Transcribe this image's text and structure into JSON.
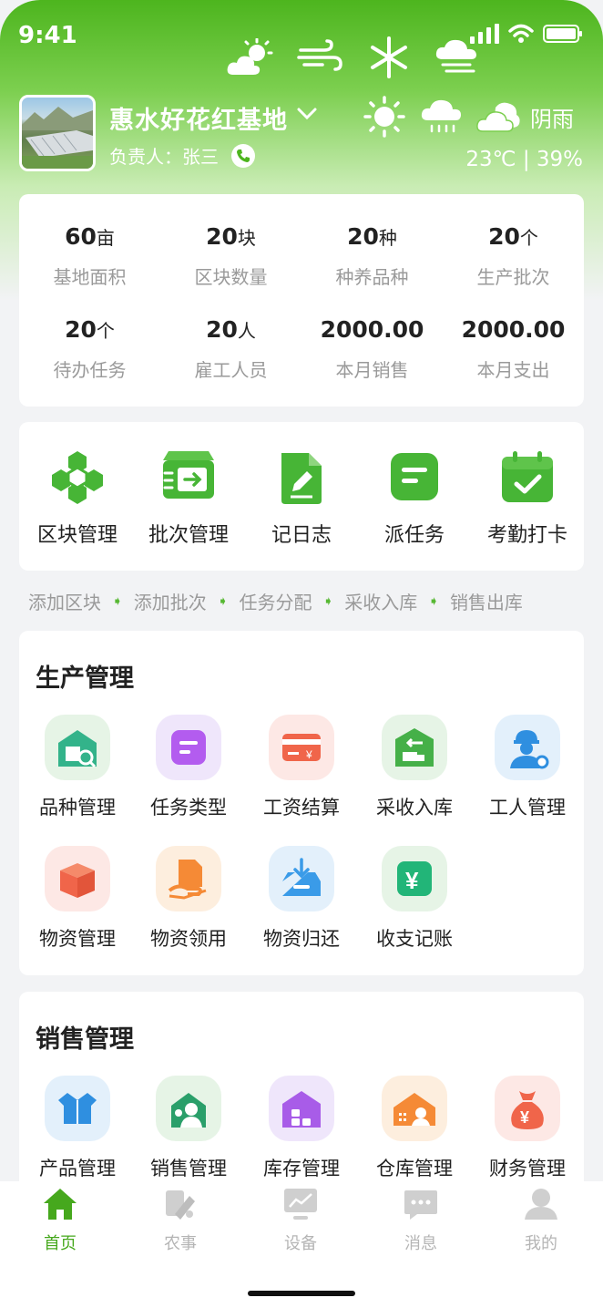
{
  "status_bar": {
    "time": "9:41"
  },
  "header": {
    "base_name": "惠水好花红基地",
    "manager": "负责人：张三",
    "weather_label": "阴雨",
    "temperature": "23℃",
    "humidity": "39%",
    "temp_humidity": "23℃ | 39%"
  },
  "stats": [
    {
      "value": "60",
      "unit": "亩",
      "label": "基地面积"
    },
    {
      "value": "20",
      "unit": "块",
      "label": "区块数量"
    },
    {
      "value": "20",
      "unit": "种",
      "label": "种养品种"
    },
    {
      "value": "20",
      "unit": "个",
      "label": "生产批次"
    },
    {
      "value": "20",
      "unit": "个",
      "label": "待办任务"
    },
    {
      "value": "20",
      "unit": "人",
      "label": "雇工人员"
    },
    {
      "value": "2000.00",
      "unit": "",
      "label": "本月销售"
    },
    {
      "value": "2000.00",
      "unit": "",
      "label": "本月支出"
    }
  ],
  "quick_actions": [
    {
      "label": "区块管理",
      "icon": "blocks-icon"
    },
    {
      "label": "批次管理",
      "icon": "batch-truck-icon"
    },
    {
      "label": "记日志",
      "icon": "log-edit-icon"
    },
    {
      "label": "派任务",
      "icon": "task-icon"
    },
    {
      "label": "考勤打卡",
      "icon": "calendar-check-icon"
    }
  ],
  "flow_steps": [
    "添加区块",
    "添加批次",
    "任务分配",
    "采收入库",
    "销售出库"
  ],
  "production": {
    "title": "生产管理",
    "items": [
      {
        "label": "品种管理",
        "icon": "variety-icon",
        "bg": "#e6f4e6",
        "color": "#33b38a"
      },
      {
        "label": "任务类型",
        "icon": "task-type-icon",
        "bg": "#efe6fb",
        "color": "#b35cef"
      },
      {
        "label": "工资结算",
        "icon": "salary-card-icon",
        "bg": "#fde8e5",
        "color": "#f0654a"
      },
      {
        "label": "采收入库",
        "icon": "harvest-storage-icon",
        "bg": "#e6f4e6",
        "color": "#45b048"
      },
      {
        "label": "工人管理",
        "icon": "worker-icon",
        "bg": "#e3f0fb",
        "color": "#2f8fe0"
      },
      {
        "label": "物资管理",
        "icon": "box-icon",
        "bg": "#fde8e5",
        "color": "#f0654a"
      },
      {
        "label": "物资领用",
        "icon": "material-receive-icon",
        "bg": "#fdeede",
        "color": "#f58a36"
      },
      {
        "label": "物资归还",
        "icon": "material-return-icon",
        "bg": "#e3f0fb",
        "color": "#3a9be8"
      },
      {
        "label": "收支记账",
        "icon": "yuan-ledger-icon",
        "bg": "#e6f4e6",
        "color": "#22b578"
      }
    ]
  },
  "sales": {
    "title": "销售管理",
    "items": [
      {
        "label": "产品管理",
        "icon": "product-box-icon",
        "bg": "#e3f0fb",
        "color": "#2f8fe0"
      },
      {
        "label": "销售管理",
        "icon": "sales-person-icon",
        "bg": "#e6f4e6",
        "color": "#2a9f6a"
      },
      {
        "label": "库存管理",
        "icon": "inventory-house-icon",
        "bg": "#efe6fb",
        "color": "#a85ce8"
      },
      {
        "label": "仓库管理",
        "icon": "warehouse-icon",
        "bg": "#fdeede",
        "color": "#f58a36"
      },
      {
        "label": "财务管理",
        "icon": "money-bag-icon",
        "bg": "#fde8e5",
        "color": "#f0654a"
      }
    ]
  },
  "tabs": [
    {
      "label": "首页",
      "icon": "home-icon",
      "active": true
    },
    {
      "label": "农事",
      "icon": "farm-icon",
      "active": false
    },
    {
      "label": "设备",
      "icon": "device-monitor-icon",
      "active": false
    },
    {
      "label": "消息",
      "icon": "message-icon",
      "active": false
    },
    {
      "label": "我的",
      "icon": "profile-icon",
      "active": false
    }
  ],
  "colors": {
    "brand_green": "#4db51e",
    "active_tab": "#46a81d",
    "muted_text": "#9a9a9a"
  }
}
